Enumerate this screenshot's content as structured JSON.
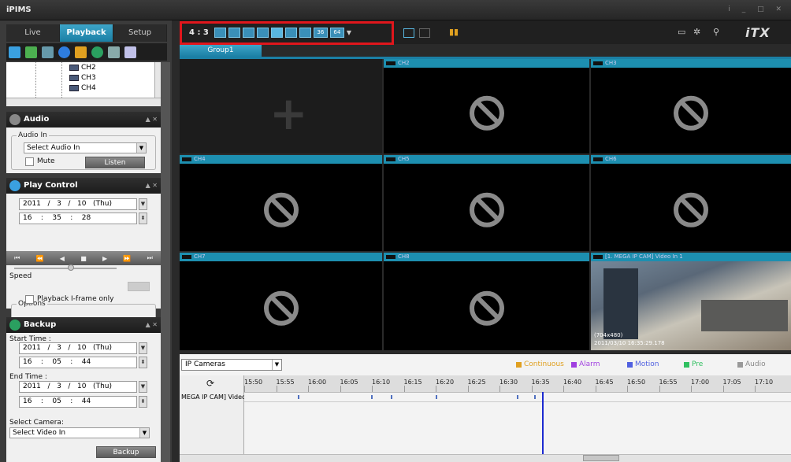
{
  "app": {
    "title": "iPIMS"
  },
  "tabs": [
    {
      "label": "Live"
    },
    {
      "label": "Playback"
    },
    {
      "label": "Setup"
    }
  ],
  "tree": {
    "channels": [
      "CH2",
      "CH3",
      "CH4"
    ]
  },
  "audio": {
    "title": "Audio",
    "group": "Audio In",
    "select": "Select Audio In",
    "mute": "Mute",
    "listen": "Listen"
  },
  "play": {
    "title": "Play Control",
    "date": "2011   /   3   /   10   (Thu)",
    "time": "16    :    35    :    28",
    "speed": "Speed",
    "options": "Options",
    "iframe": "Playback I-frame only"
  },
  "backup": {
    "title": "Backup",
    "start": "Start Time :",
    "start_date": "2011   /   3   /   10   (Thu)",
    "start_time": "16    :    05    :    44",
    "end": "End Time :",
    "end_date": "2011   /   3   /   10   (Thu)",
    "end_time": "16    :    05    :    44",
    "cam_label": "Select Camera:",
    "cam_select": "Select Video In",
    "button": "Backup"
  },
  "toolbar": {
    "ratio": "4 : 3",
    "n36": "36",
    "n64": "64",
    "logo": "iTX"
  },
  "group": {
    "label": "Group1"
  },
  "cells": [
    {
      "label": ""
    },
    {
      "label": "CH2"
    },
    {
      "label": "CH3"
    },
    {
      "label": "CH4"
    },
    {
      "label": "CH5"
    },
    {
      "label": "CH6"
    },
    {
      "label": "CH7"
    },
    {
      "label": "CH8"
    },
    {
      "label": "[1. MEGA IP CAM] Video In 1",
      "res": "(704x480)",
      "ts": "2011/03/10 16:35:29.178"
    }
  ],
  "bottom": {
    "select": "IP Cameras",
    "legend": [
      "Continuous",
      "Alarm",
      "Motion",
      "Pre",
      "Audio"
    ],
    "row": "MEGA IP CAM] Video",
    "ticks": [
      "15:50",
      "15:55",
      "16:00",
      "16:05",
      "16:10",
      "16:15",
      "16:20",
      "16:25",
      "16:30",
      "16:35",
      "16:40",
      "16:45",
      "16:50",
      "16:55",
      "17:00",
      "17:05",
      "17:10"
    ]
  },
  "colors": {
    "accent": "#1b7fa5",
    "highlight": "#e0161c",
    "cursor": "#1c2ad0"
  }
}
